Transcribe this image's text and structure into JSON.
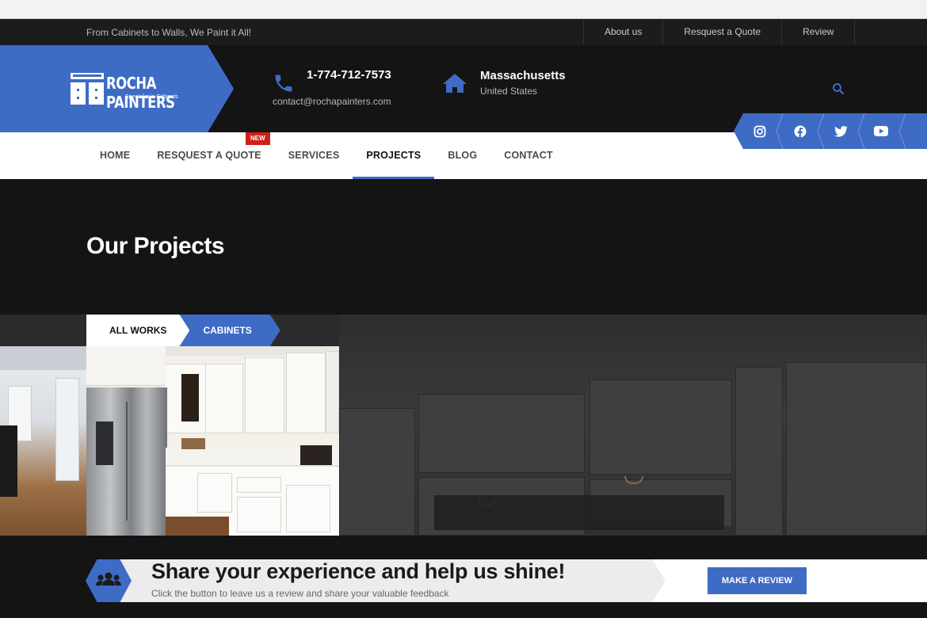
{
  "topbar": {
    "tagline": "From Cabinets to Walls, We Paint it All!",
    "links": [
      "About us",
      "Resquest a Quote",
      "Review"
    ]
  },
  "header": {
    "logo_name": "ROCHA PAINTERS",
    "logo_sub": "Specialist in Cabinets",
    "phone": "1-774-712-7573",
    "email": "contact@rochapainters.com",
    "state": "Massachusetts",
    "country": "United States"
  },
  "nav": {
    "items": [
      "HOME",
      "RESQUEST A QUOTE",
      "SERVICES",
      "PROJECTS",
      "BLOG",
      "CONTACT"
    ],
    "active": "PROJECTS",
    "badge": "NEW"
  },
  "social": [
    "instagram-icon",
    "facebook-icon",
    "twitter-icon",
    "youtube-icon"
  ],
  "page": {
    "title": "Our Projects"
  },
  "filters": {
    "all": "ALL WORKS",
    "cabinets": "CABINETS"
  },
  "cta": {
    "title": "Share your experience and help us shine!",
    "subtitle": "Click the button to leave us a review and share your valuable feedback",
    "button": "MAKE A REVIEW"
  },
  "colors": {
    "accent": "#3e6bc4",
    "dark": "#141414",
    "badge": "#d0201a"
  }
}
